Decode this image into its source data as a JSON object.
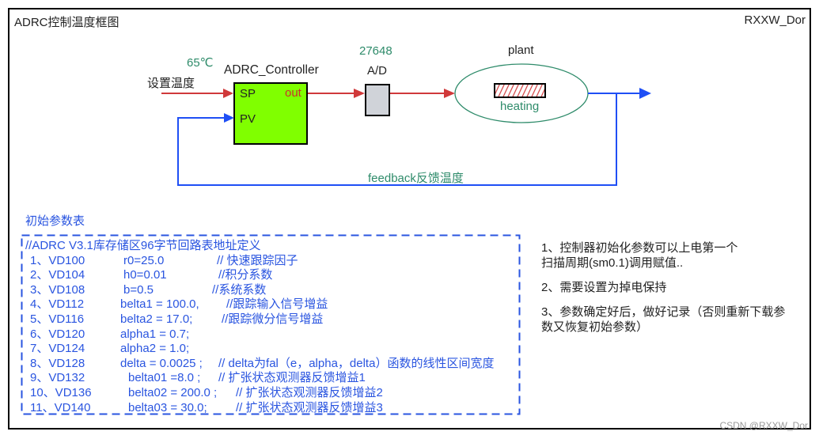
{
  "frame": {
    "title": "ADRC控制温度框图",
    "author": "RXXW_Dor",
    "watermark": "CSDN @RXXW_Dor"
  },
  "diagram": {
    "setpoint_value": "65℃",
    "setpoint_label": "设置温度",
    "controller": {
      "name": "ADRC_Controller",
      "input_sp": "SP",
      "input_pv": "PV",
      "output": "out",
      "fill_color": "#80ff00"
    },
    "ad": {
      "value": "27648",
      "label": "A/D",
      "fill_color": "#d0d3d9"
    },
    "plant": {
      "label": "plant",
      "inner_label": "heating"
    },
    "feedback_label": "feedback反馈温度",
    "colors": {
      "forward_line": "#d0393a",
      "feedback_line": "#1f4ff5",
      "green_text": "#2e8b6a"
    }
  },
  "param_table": {
    "title": "初始参数表",
    "header": "//ADRC V3.1库存储区96字节回路表地址定义",
    "rows": [
      {
        "index": "1、VD100",
        "expr": "r0=25.0",
        "comment": "// 快速跟踪因子"
      },
      {
        "index": "2、VD104",
        "expr": "h0=0.01",
        "comment": "//积分系数"
      },
      {
        "index": "3、VD108",
        "expr": "b=0.5",
        "comment": "//系统系数"
      },
      {
        "index": "4、VD112",
        "expr": "belta1 = 100.0,",
        "comment": "//跟踪输入信号增益"
      },
      {
        "index": "5、VD116",
        "expr": "belta2 = 17.0;",
        "comment": "//跟踪微分信号增益"
      },
      {
        "index": "6、VD120",
        "expr": "alpha1 = 0.7;",
        "comment": ""
      },
      {
        "index": "7、VD124",
        "expr": "alpha2 = 1.0;",
        "comment": ""
      },
      {
        "index": "8、VD128",
        "expr": "delta = 0.0025 ;",
        "comment": "// delta为fal（e，alpha，delta）函数的线性区间宽度"
      },
      {
        "index": "9、VD132",
        "expr": "belta01 =8.0 ;",
        "comment": "// 扩张状态观测器反馈增益1"
      },
      {
        "index": "10、VD136",
        "expr": "belta02 = 200.0 ;",
        "comment": "// 扩张状态观测器反馈增益2"
      },
      {
        "index": "11、VD140",
        "expr": "belta03 = 30.0;",
        "comment": "// 扩张状态观测器反馈增益3"
      }
    ]
  },
  "notes": [
    "1、控制器初始化参数可以上电第一个扫描周期(sm0.1)调用赋值..",
    "2、需要设置为掉电保持",
    "3、参数确定好后，做好记录（否则重新下载参数又恢复初始参数）"
  ]
}
